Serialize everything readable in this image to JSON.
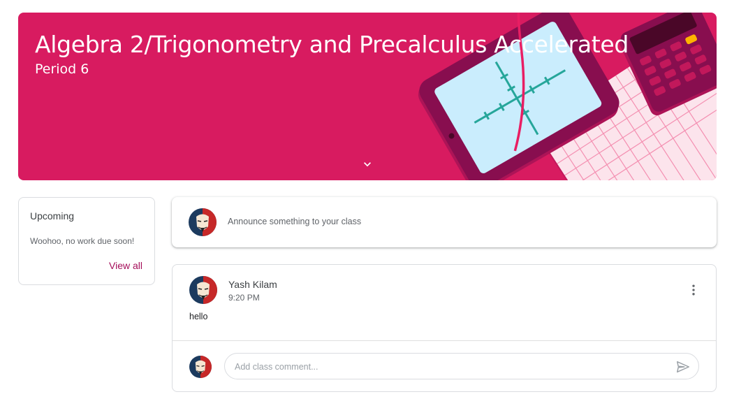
{
  "banner": {
    "class_name": "Algebra 2/Trigonometry and Precalculus Accelerated",
    "section": "Period 6",
    "theme_color": "#d81b60",
    "expand_icon": "chevron-down-icon"
  },
  "upcoming": {
    "title": "Upcoming",
    "empty_message": "Woohoo, no work due soon!",
    "view_all_label": "View all",
    "link_color": "#a50e5a"
  },
  "announce": {
    "prompt": "Announce something to your class"
  },
  "post": {
    "author": "Yash Kilam",
    "time": "9:20 PM",
    "body": "hello",
    "menu_icon": "more-vert-icon",
    "comment_placeholder": "Add class comment...",
    "send_icon": "send-icon"
  }
}
